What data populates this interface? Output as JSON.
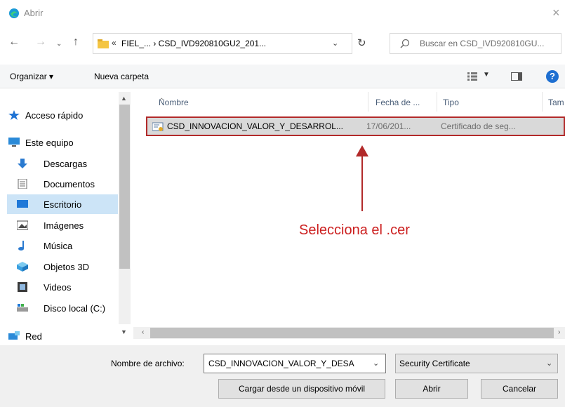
{
  "window": {
    "title": "Abrir",
    "close_glyph": "×"
  },
  "nav": {
    "back_icon": "back-arrow-icon",
    "forward_icon": "forward-arrow-icon",
    "recent_icon": "chevron-down-icon",
    "up_icon": "up-arrow-icon",
    "path_prefix": "«",
    "path": "FIEL_... › CSD_IVD920810GU2_201...",
    "refresh_icon": "refresh-icon",
    "search_placeholder": "Buscar en CSD_IVD920810GU..."
  },
  "toolbar": {
    "organize_label": "Organizar ▾",
    "new_folder_label": "Nueva carpeta"
  },
  "sidebar": {
    "items": [
      {
        "label": "Acceso rápido",
        "icon": "star-icon",
        "color": "#1e73d4"
      },
      {
        "label": "Este equipo",
        "icon": "computer-icon",
        "color": "#2a8ad8"
      },
      {
        "label": "Descargas",
        "icon": "download-icon",
        "color": "#2a7ad0"
      },
      {
        "label": "Documentos",
        "icon": "document-icon",
        "color": "#6a6a6a"
      },
      {
        "label": "Escritorio",
        "icon": "desktop-icon",
        "color": "#1e78d8"
      },
      {
        "label": "Imágenes",
        "icon": "pictures-icon",
        "color": "#4a4a4a"
      },
      {
        "label": "Música",
        "icon": "music-icon",
        "color": "#2a7ad0"
      },
      {
        "label": "Objetos 3D",
        "icon": "3d-objects-icon",
        "color": "#3aa0e0"
      },
      {
        "label": "Videos",
        "icon": "video-icon",
        "color": "#3a3a3a"
      },
      {
        "label": "Disco local (C:)",
        "icon": "drive-icon",
        "color": "#1e78d8"
      },
      {
        "label": "Red",
        "icon": "network-icon",
        "color": "#2a8ad8"
      }
    ]
  },
  "columns": {
    "name": "Nombre",
    "date": "Fecha de ...",
    "type": "Tipo",
    "size": "Tam"
  },
  "files": [
    {
      "name": "CSD_INNOVACION_VALOR_Y_DESARROL...",
      "date": "17/06/201...",
      "type": "Certificado de seg..."
    }
  ],
  "annotation": {
    "text": "Selecciona el .cer",
    "color": "#cc1f1f"
  },
  "bottom": {
    "filename_label": "Nombre de archivo:",
    "filename_value": "CSD_INNOVACION_VALOR_Y_DESA",
    "filetype_value": "Security Certificate",
    "mobile_button": "Cargar desde un dispositivo móvil",
    "open_button": "Abrir",
    "cancel_button": "Cancelar"
  }
}
